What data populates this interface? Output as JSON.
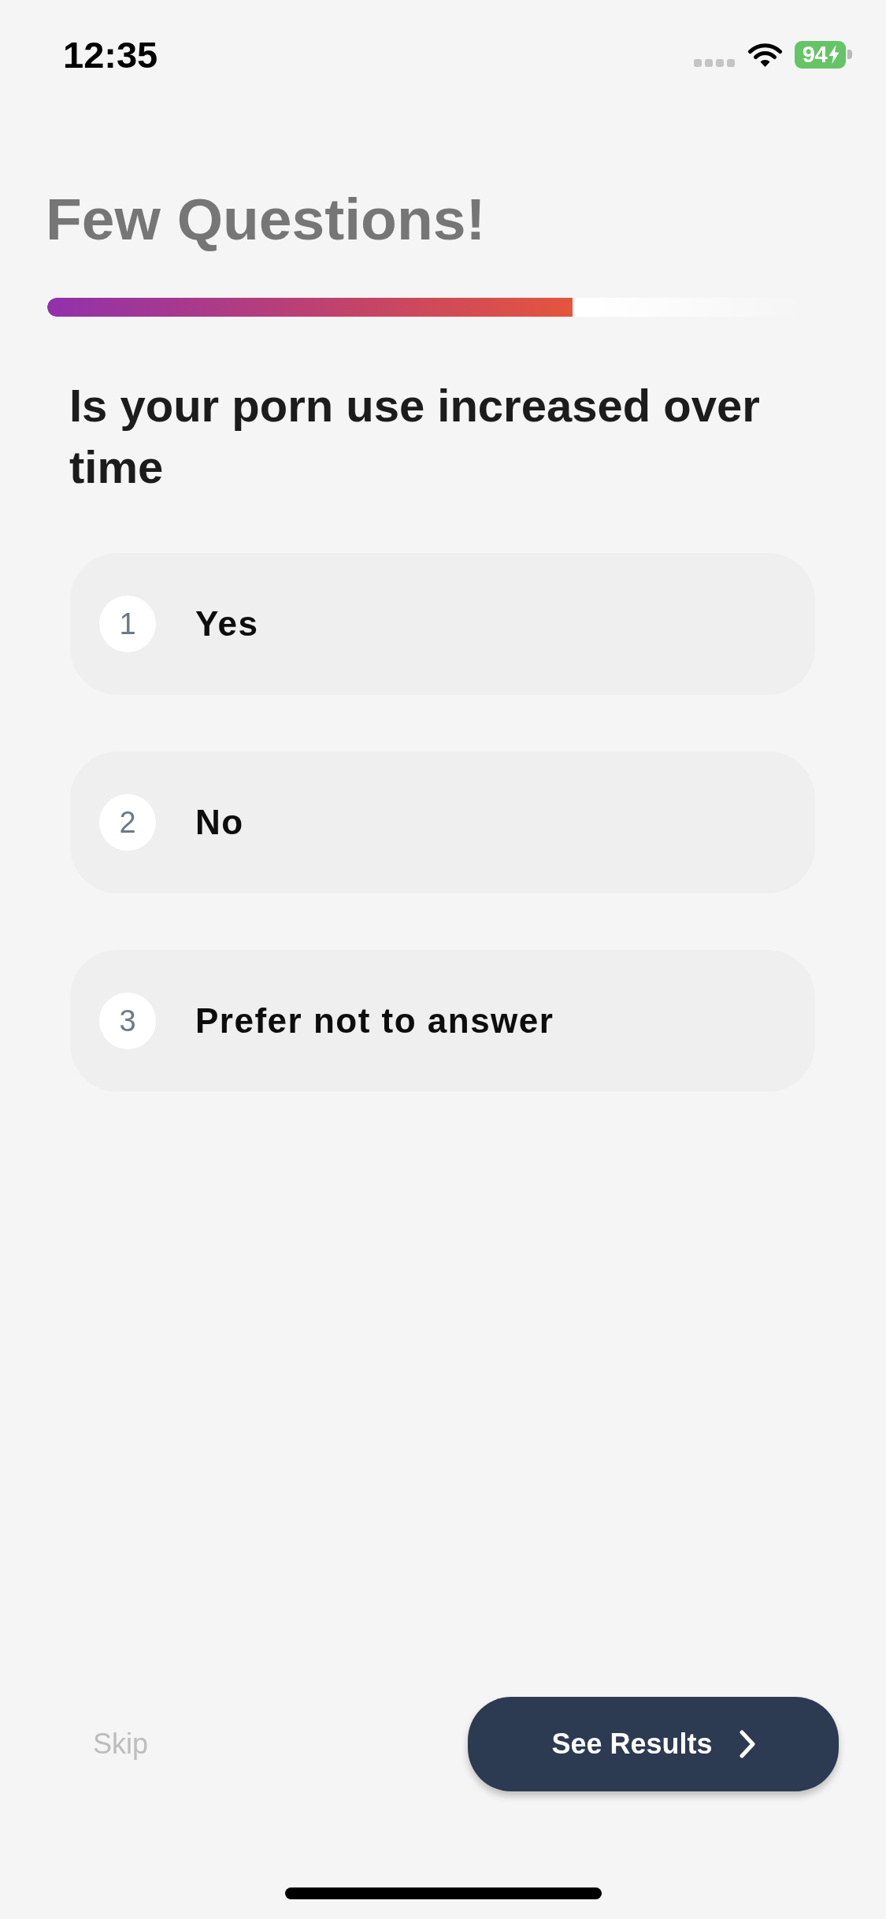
{
  "status_bar": {
    "time": "12:35",
    "battery": "94",
    "charging": true
  },
  "header": {
    "title": "Few Questions!"
  },
  "progress": {
    "level": 0.69
  },
  "question": {
    "text": "Is your porn use increased over time"
  },
  "options": [
    {
      "number": "1",
      "label": "Yes",
      "selected": false
    },
    {
      "number": "2",
      "label": "No",
      "selected": false
    },
    {
      "number": "3",
      "label": "Prefer not to answer",
      "selected": false
    }
  ],
  "footer": {
    "skip": "Skip",
    "next_button": "See Results"
  }
}
